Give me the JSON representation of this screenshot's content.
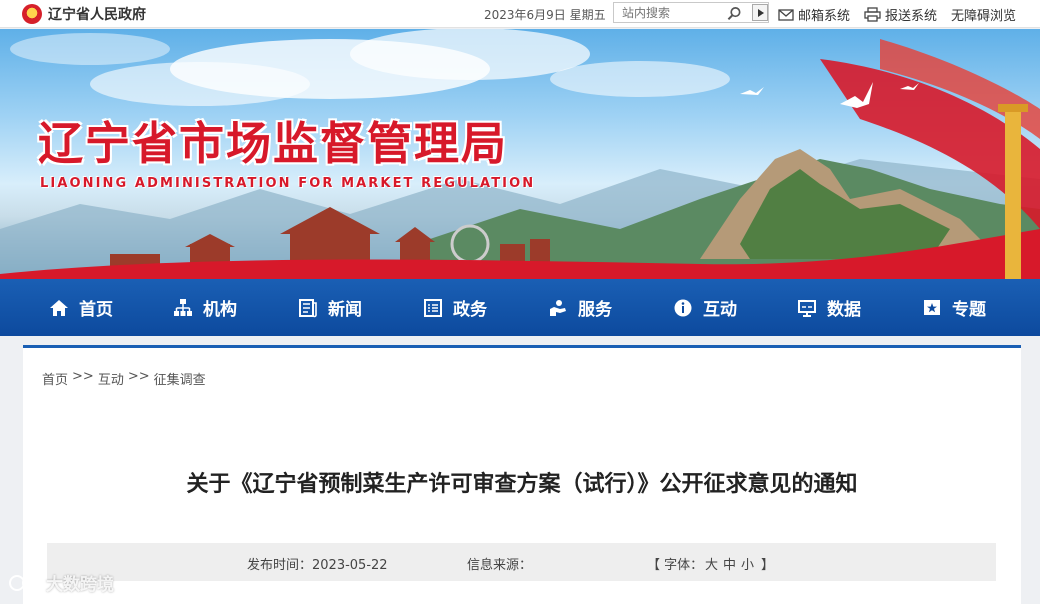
{
  "topbar": {
    "gov_name": "辽宁省人民政府",
    "date": "2023年6月9日 星期五",
    "search_placeholder": "站内搜索",
    "mail_label": "邮箱系统",
    "report_label": "报送系统",
    "accessible_label": "无障碍浏览"
  },
  "banner": {
    "title": "辽宁省市场监督管理局",
    "subtitle": "LIAONING ADMINISTRATION FOR MARKET REGULATION"
  },
  "nav": {
    "items": [
      {
        "label": "首页",
        "icon": "home-icon"
      },
      {
        "label": "机构",
        "icon": "org-chart-icon"
      },
      {
        "label": "新闻",
        "icon": "news-icon"
      },
      {
        "label": "政务",
        "icon": "list-icon"
      },
      {
        "label": "服务",
        "icon": "service-icon"
      },
      {
        "label": "互动",
        "icon": "info-icon"
      },
      {
        "label": "数据",
        "icon": "data-icon"
      },
      {
        "label": "专题",
        "icon": "star-icon"
      }
    ]
  },
  "breadcrumb": {
    "items": [
      "首页",
      "互动",
      "征集调查"
    ],
    "separator": ">>"
  },
  "article": {
    "title": "关于《辽宁省预制菜生产许可审查方案（试行）》公开征求意见的通知",
    "publish_time": "发布时间：2023-05-22",
    "source": "信息来源：",
    "font_label": "【 字体：",
    "font_large": "大",
    "font_medium": "中",
    "font_small": "小",
    "font_close": "】"
  },
  "watermark": "大数跨境",
  "colors": {
    "nav_blue": "#1a5fb4",
    "title_red": "#d7192a",
    "meta_bg": "#eeeeee"
  }
}
